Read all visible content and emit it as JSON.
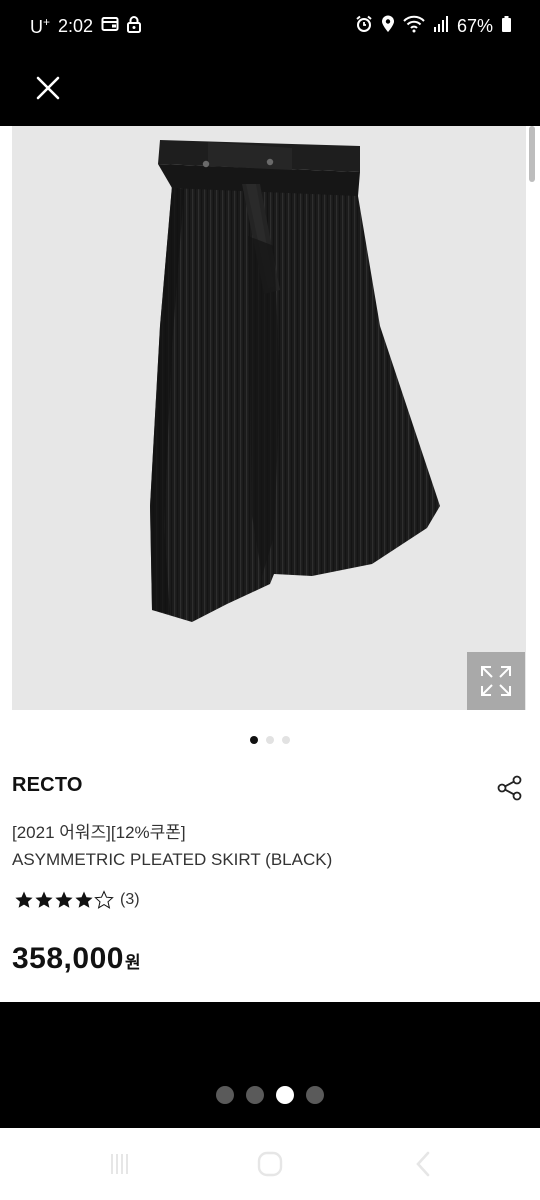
{
  "status_bar": {
    "carrier": "U",
    "carrier_sup": "+",
    "time": "2:02",
    "battery": "67%",
    "icons": [
      "wallet-icon",
      "lock-icon",
      "alarm-icon",
      "location-icon",
      "wifi-icon",
      "signal-icon",
      "battery-icon"
    ]
  },
  "topbar": {
    "close_icon": "close-icon"
  },
  "product": {
    "image_dots": {
      "count": 3,
      "active": 0
    },
    "brand": "RECTO",
    "promo": "[2021 어워즈][12%쿠폰]",
    "name": "ASYMMETRIC PLEATED SKIRT (BLACK)",
    "rating": {
      "stars": 4.5,
      "count": "(3)"
    },
    "price": "358,000",
    "price_unit": "원"
  },
  "viewer": {
    "page_dots": {
      "count": 4,
      "active": 2
    }
  },
  "navbar": {
    "buttons": [
      "recent-apps-icon",
      "home-icon",
      "back-icon"
    ]
  },
  "colors": {
    "background": "#000000",
    "image_bg": "#e7e7e7",
    "text": "#111111"
  }
}
